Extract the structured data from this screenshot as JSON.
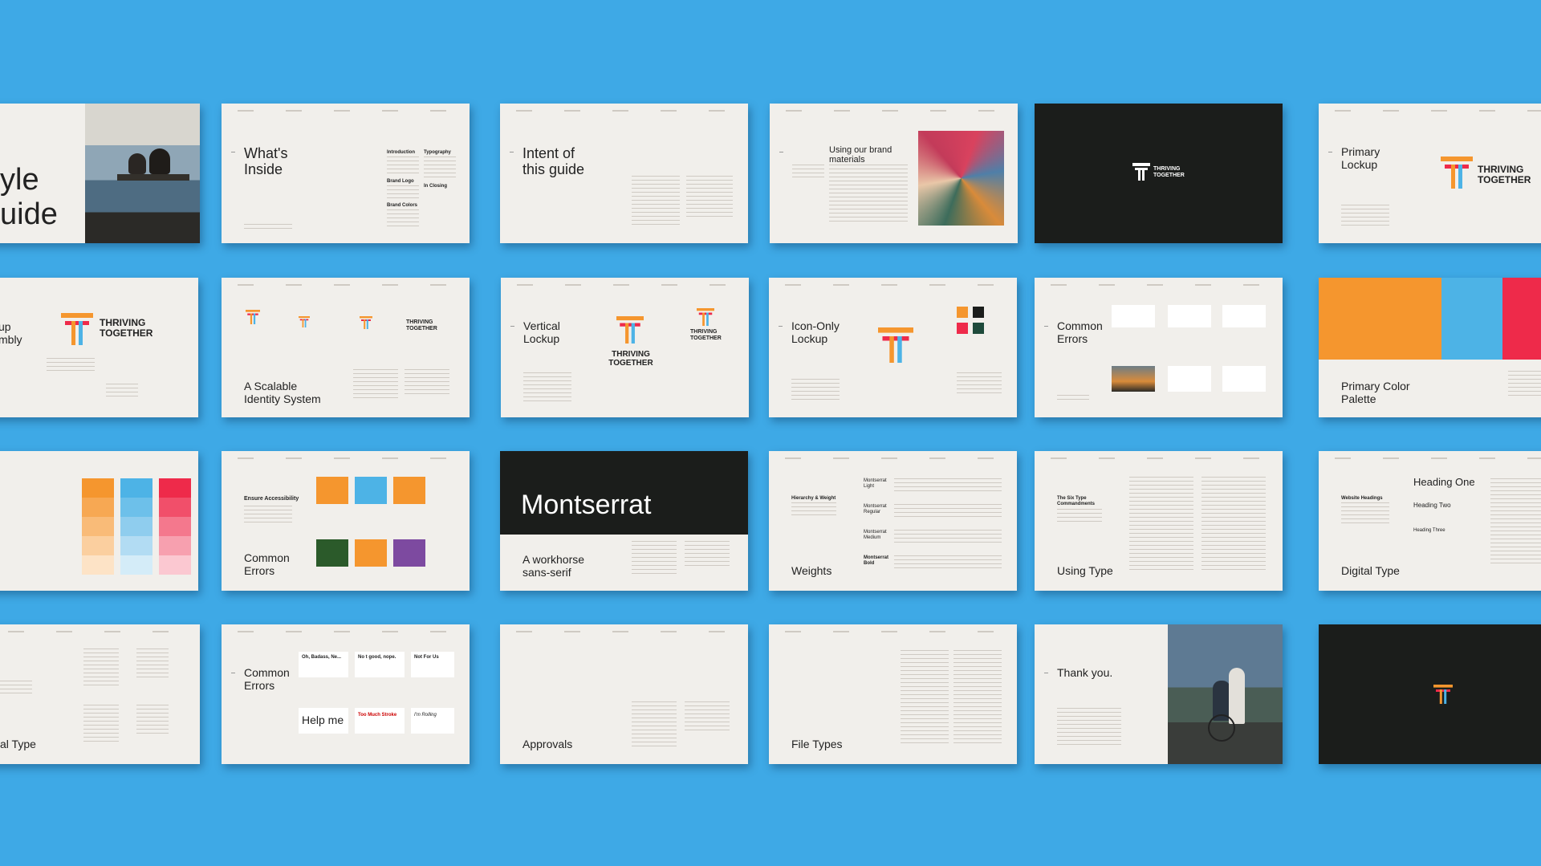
{
  "brand": {
    "name_line1": "THRIVING",
    "name_line2": "TOGETHER"
  },
  "colors": {
    "background": "#3ea9e6",
    "orange": "#f5962e",
    "blue": "#4db3e6",
    "red": "#ee2a4a",
    "dark": "#1b1d1b",
    "paper": "#f1efeb"
  },
  "icons": {
    "logo": "t-mark-icon",
    "photo": "photo-placeholder"
  },
  "slides": {
    "style_guide_l1": "yle",
    "style_guide_l2": "uide",
    "whats_inside": "What's\nInside",
    "toc_introduction": "Introduction",
    "toc_typography": "Typography",
    "toc_brand_logo": "Brand Logo",
    "toc_brand_colors": "Brand Colors",
    "toc_in_closing": "In Closing",
    "intent": "Intent of\nthis guide",
    "using_materials": "Using our brand\nmaterials",
    "primary_lockup": "Primary\nLockup",
    "assembly": "up\nmbly",
    "scalable": "A Scalable\nIdentity System",
    "vertical_lockup": "Vertical\nLockup",
    "icon_only": "Icon-Only\nLockup",
    "common_errors": "Common\nErrors",
    "primary_palette": "Primary Color\nPalette",
    "ensure_accessibility": "Ensure Accessibility",
    "montserrat": "Montserrat",
    "workhorse": "A workhorse\nsans-serif",
    "hierarchy": "Hierarchy & Weight",
    "weight_light": "Montserrat\nLight",
    "weight_regular": "Montserrat\nRegular",
    "weight_medium": "Montserrat\nMedium",
    "weight_bold": "Montserrat\nBold",
    "weights": "Weights",
    "six_type": "The Six Type\nCommandments",
    "using_type": "Using Type",
    "website_headings": "Website Headings",
    "heading_one": "Heading One",
    "heading_two": "Heading Two",
    "heading_three": "Heading Three",
    "digital_type": "Digital Type",
    "print_type": "al Type",
    "errors_oh": "Oh, Badass, Ne...",
    "errors_no": "No t good, nope.",
    "errors_not": "Not For Us",
    "errors_help": "Help me",
    "errors_stroke": "Too Much Stroke",
    "errors_thanks": "I'm Rolling",
    "approvals": "Approvals",
    "file_types": "File Types",
    "thank_you": "Thank you."
  }
}
